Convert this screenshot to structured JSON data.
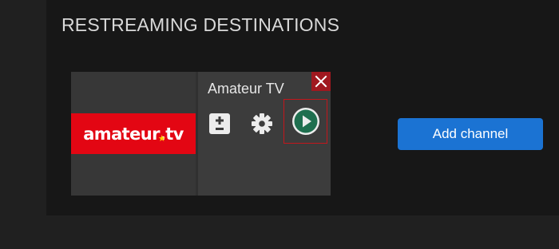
{
  "section": {
    "title": "RESTREAMING DESTINATIONS"
  },
  "destination_card": {
    "channel_name": "Amateur TV",
    "logo": {
      "text": "amateur.tv",
      "band_color": "#e30613",
      "star_color": "#ffcc00"
    },
    "icons": {
      "close": "close-icon",
      "volume": "plus-minus-icon",
      "settings": "gear-icon",
      "play": "play-icon"
    },
    "play_icon_color": "#1f6f4f"
  },
  "actions": {
    "add_channel_label": "Add channel"
  },
  "colors": {
    "accent": "#1b73d3",
    "danger": "#a0181f"
  }
}
